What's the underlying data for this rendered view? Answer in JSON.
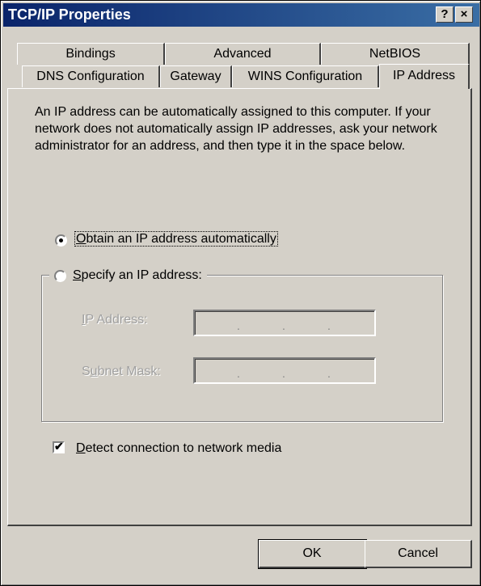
{
  "window": {
    "title": "TCP/IP Properties"
  },
  "titlebar_buttons": {
    "help": "?",
    "close": "×"
  },
  "tabs_back": [
    "Bindings",
    "Advanced",
    "NetBIOS"
  ],
  "tabs_front": [
    "DNS Configuration",
    "Gateway",
    "WINS Configuration",
    "IP Address"
  ],
  "active_tab": "IP Address",
  "description": "An IP address can be automatically assigned to this computer. If your network does not automatically assign IP addresses, ask your network administrator for an address, and then type it in the space below.",
  "options": {
    "obtain": {
      "prefix": "",
      "key": "O",
      "rest": "btain an IP address automatically",
      "selected": true
    },
    "specify": {
      "prefix": "",
      "key": "S",
      "rest": "pecify an IP address:",
      "selected": false
    }
  },
  "fields": {
    "ip_address": {
      "prefix": "",
      "key": "I",
      "rest": "P Address:",
      "value": "",
      "separator": "."
    },
    "subnet_mask": {
      "prefix": "S",
      "key": "u",
      "rest": "bnet Mask:",
      "value": "",
      "separator": "."
    }
  },
  "detect": {
    "prefix": "",
    "key": "D",
    "rest": "etect connection to network media",
    "checked": true
  },
  "buttons": {
    "ok": "OK",
    "cancel": "Cancel"
  }
}
